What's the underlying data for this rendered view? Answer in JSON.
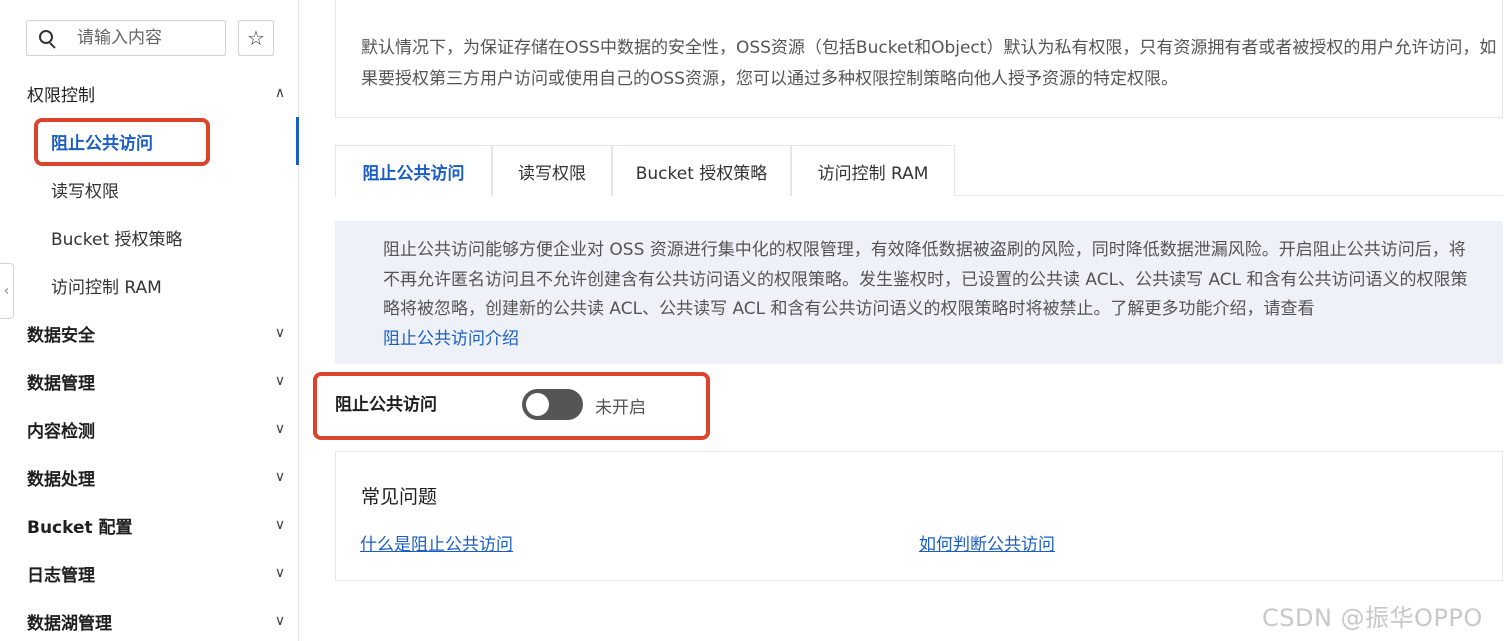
{
  "sidebar": {
    "search_placeholder": "请输入内容",
    "star_icon": "☆",
    "groups": [
      {
        "label": "权限控制",
        "chevron": "∧",
        "expanded": true
      },
      {
        "label": "数据安全",
        "chevron": "∨"
      },
      {
        "label": "数据管理",
        "chevron": "∨"
      },
      {
        "label": "内容检测",
        "chevron": "∨"
      },
      {
        "label": "数据处理",
        "chevron": "∨"
      },
      {
        "label": "Bucket 配置",
        "chevron": "∨"
      },
      {
        "label": "日志管理",
        "chevron": "∨"
      },
      {
        "label": "数据湖管理",
        "chevron": "∨"
      }
    ],
    "items": [
      {
        "label": "阻止公共访问",
        "active": true
      },
      {
        "label": "读写权限"
      },
      {
        "label": "Bucket 授权策略"
      },
      {
        "label": "访问控制 RAM"
      }
    ],
    "collapse_icon": "‹"
  },
  "main": {
    "intro": "默认情况下，为保证存储在OSS中数据的安全性，OSS资源（包括Bucket和Object）默认为私有权限，只有资源拥有者或者被授权的用户允许访问，如果要授权第三方用户访问或使用自己的OSS资源，您可以通过多种权限控制策略向他人授予资源的特定权限。",
    "tabs": [
      {
        "label": "阻止公共访问",
        "active": true
      },
      {
        "label": "读写权限"
      },
      {
        "label": "Bucket 授权策略"
      },
      {
        "label": "访问控制 RAM"
      }
    ],
    "info_text": "阻止公共访问能够方便企业对 OSS 资源进行集中化的权限管理，有效降低数据被盗刷的风险，同时降低数据泄漏风险。开启阻止公共访问后，将不再允许匿名访问且不允许创建含有公共访问语义的权限策略。发生鉴权时，已设置的公共读 ACL、公共读写 ACL 和含有公共访问语义的权限策略将被忽略，创建新的公共读 ACL、公共读写 ACL 和含有公共访问语义的权限策略时将被禁止。了解更多功能介绍，请查看",
    "info_link": "阻止公共访问介绍",
    "toggle": {
      "label": "阻止公共访问",
      "state_text": "未开启",
      "enabled": false
    },
    "faq": {
      "title": "常见问题",
      "links": [
        "什么是阻止公共访问",
        "如何判断公共访问"
      ]
    }
  },
  "colors": {
    "accent": "#1a5ec3",
    "highlight_frame": "#d9442b",
    "info_bg": "#eef1f7"
  },
  "watermark": "CSDN @振华OPPO"
}
